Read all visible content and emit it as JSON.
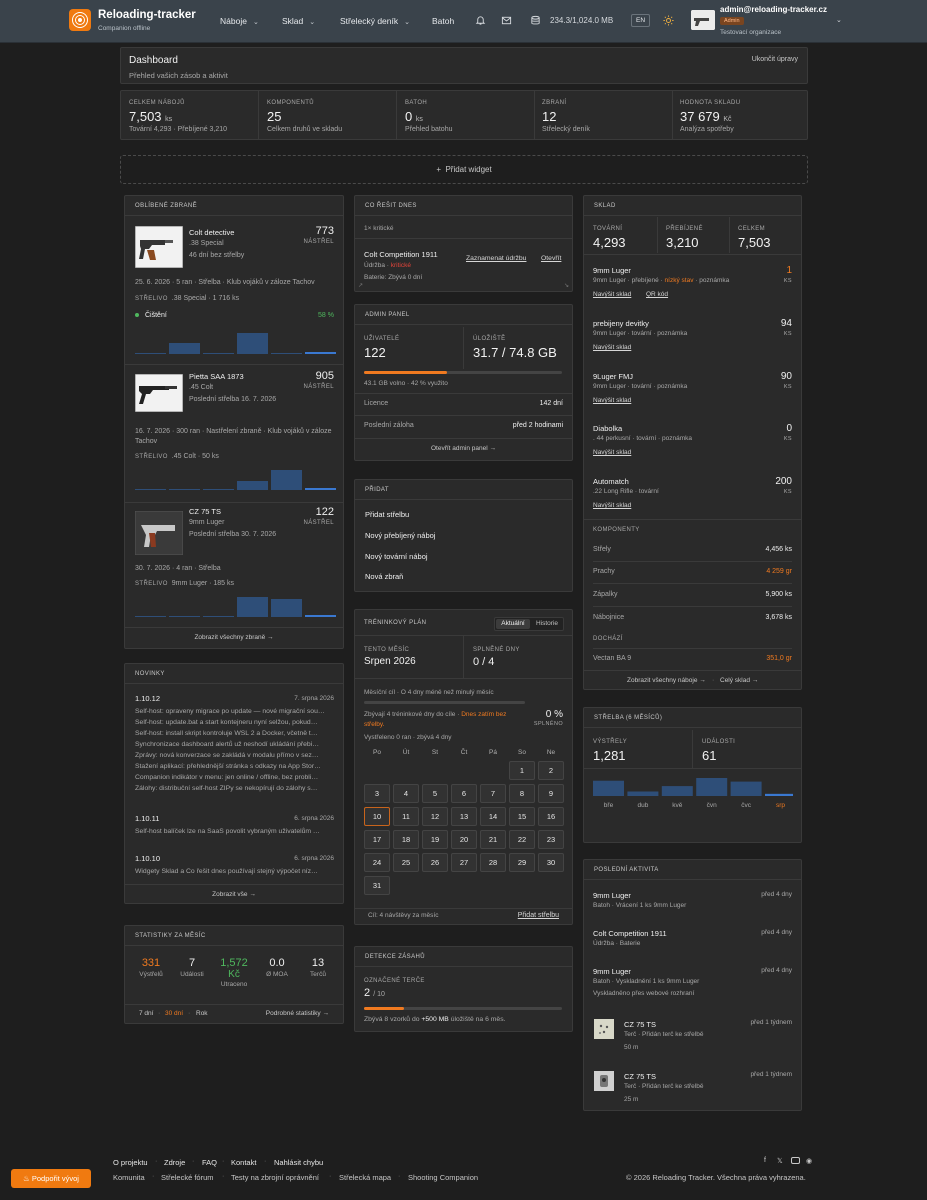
{
  "header": {
    "brand": "Reloading-tracker",
    "brand_sub": "Companion offline",
    "nav": [
      "Náboje",
      "Sklad",
      "Střelecký deník",
      "Batoh"
    ],
    "storage": "234.3/1,024.0 MB",
    "lang": "EN",
    "email": "admin@reloading-tracker.cz",
    "role": "Admin",
    "org": "Testovací organizace"
  },
  "dashboard": {
    "title": "Dashboard",
    "subtitle": "Přehled vašich zásob a aktivit",
    "end_edit": "Ukončit úpravy"
  },
  "stats": [
    {
      "label": "CELKEM NÁBOJŮ",
      "value": "7,503",
      "unit": "ks",
      "sub": "Tovární 4,293 · Přebíjené 3,210"
    },
    {
      "label": "KOMPONENTŮ",
      "value": "25",
      "unit": "",
      "sub": "Celkem druhů ve skladu"
    },
    {
      "label": "BATOH",
      "value": "0",
      "unit": "ks",
      "sub": "Přehled batohu"
    },
    {
      "label": "ZBRANÍ",
      "value": "12",
      "unit": "",
      "sub": "Střelecký deník"
    },
    {
      "label": "HODNOTA SKLADU",
      "value": "37 679",
      "unit": "Kč",
      "sub": "Analýza spotřeby"
    }
  ],
  "add_widget": "Přidat widget",
  "fav": {
    "title": "OBLÍBENÉ ZBRANĚ",
    "guns": [
      {
        "name": "Colt detective",
        "cal": ".38 Special",
        "last": "46 dní bez střelby",
        "shots": "773",
        "shots_label": "NÁSTŘEL",
        "log": "25. 6. 2026 · 5 ran · Střelba · Klub vojáků v záloze Tachov",
        "ammo_label": "STŘELIVO",
        "ammo": ".38 Special · 1 716 ks",
        "clean": "Čištění",
        "clean_pct": "58 %",
        "bars": [
          0.05,
          0.45,
          0.05,
          0.85,
          0.05,
          0.08
        ]
      },
      {
        "name": "Pietta SAA 1873",
        "cal": ".45 Colt",
        "last": "Poslední střelba 16. 7. 2026",
        "shots": "905",
        "shots_label": "NÁSTŘEL",
        "log": "16. 7. 2026 · 300 ran · Nastřelení zbraně · Klub vojáků v záloze Tachov",
        "ammo_label": "STŘELIVO",
        "ammo": ".45 Colt · 50 ks",
        "bars": [
          0.05,
          0.05,
          0.05,
          0.35,
          0.85,
          0.08
        ]
      },
      {
        "name": "CZ 75 TS",
        "cal": "9mm Luger",
        "last": "Poslední střelba 30. 7. 2026",
        "shots": "122",
        "shots_label": "NÁSTŘEL",
        "log": "30. 7. 2026 · 4 ran · Střelba",
        "ammo_label": "STŘELIVO",
        "ammo": "9mm Luger · 185 ks",
        "bars": [
          0.05,
          0.05,
          0.05,
          0.85,
          0.75,
          0.08
        ]
      }
    ],
    "show_all": "Zobrazit všechny zbraně →"
  },
  "news": {
    "title": "NOVINKY",
    "entries": [
      {
        "ver": "1.10.12",
        "date": "7. srpna 2026",
        "lines": [
          "Self-host: opraveny migrace po update — nové migrační sou…",
          "Self-host: update.bat a start kontejneru nyní selžou, pokud…",
          "Self-host: install skript kontroluje WSL 2 a Docker, včetně t…",
          "Synchronizace dashboard alertů už neshodí ukládání přebi…",
          "Zprávy: nová konverzace se zakládá v modalu přímo v sez…",
          "Stažení aplikací: přehlednější stránka s odkazy na App Stor…",
          "Companion indikátor v menu: jen online / offline, bez probli…",
          "Zálohy: distribuční self-host ZIPy se nekopírují do zálohy s…"
        ]
      },
      {
        "ver": "1.10.11",
        "date": "6. srpna 2026",
        "lines": [
          "Self-host balíček lze na SaaS povolit vybraným uživatelům …"
        ]
      },
      {
        "ver": "1.10.10",
        "date": "6. srpna 2026",
        "lines": [
          "Widgety Sklad a Co řešit dnes používají stejný výpočet níz…"
        ]
      }
    ],
    "show_all": "Zobrazit vše →"
  },
  "monthstats": {
    "title": "STATISTIKY ZA MĚSÍC",
    "items": [
      {
        "value": "331",
        "label": "Výstřelů"
      },
      {
        "value": "7",
        "label": "Události"
      },
      {
        "value": "1,572",
        "unit": "Kč",
        "label": "Utraceno"
      },
      {
        "value": "0.0",
        "label": "Ø MOA"
      },
      {
        "value": "13",
        "label": "Terčů"
      }
    ],
    "ranges": [
      "7 dní",
      "30 dní",
      "Rok"
    ],
    "detail": "Podrobné statistiky →"
  },
  "today": {
    "title": "CO ŘEŠIT DNES",
    "critical": "1× kritické",
    "item": "Colt Competition 1911",
    "item_sub1": "Údržba · ",
    "item_sub1b": "kritické",
    "item_sub2": "Baterie: Zbývá 0 dní",
    "act1": "Zaznamenat údržbu",
    "act2": "Otevřít"
  },
  "admin": {
    "title": "ADMIN PANEL",
    "users_label": "UŽIVATELÉ",
    "users": "122",
    "storage_label": "ÚLOŽIŠTĚ",
    "storage": "31.7 / 74.8 GB",
    "storage_fill": 0.42,
    "free": "43.1 GB volno · 42 % využito",
    "licence_label": "Licence",
    "licence": "142 dní",
    "backup_label": "Poslední záloha",
    "backup": "před 2 hodinami",
    "open": "Otevřít admin panel →"
  },
  "add": {
    "title": "PŘIDAT",
    "items": [
      "Přidat střelbu",
      "Nový přebíjený náboj",
      "Nový tovární náboj",
      "Nová zbraň"
    ]
  },
  "plan": {
    "title": "TRÉNINKOVÝ PLÁN",
    "tabs": [
      "Aktuální",
      "Historie"
    ],
    "month_label": "TENTO MĚSÍC",
    "month": "Srpen 2026",
    "done_label": "SPLNĚNÉ DNY",
    "done": "0 / 4",
    "goal": "Měsíční cíl · O 4 dny méně než minulý měsíc",
    "remain": "Zbývají 4 tréninkové dny do cíle · ",
    "remain_warn": "Dnes zatím bez",
    "remain_warn2": "střelby.",
    "pct": "0 %",
    "pct_label": "SPLNĚNO",
    "fulfilled": "Vystřeleno 0 ran · zbývá 4 dny",
    "weekdays": [
      "Po",
      "Út",
      "St",
      "Čt",
      "Pá",
      "So",
      "Ne"
    ],
    "days": [
      "1",
      "2",
      "3",
      "4",
      "5",
      "6",
      "7",
      "8",
      "9",
      "10",
      "11",
      "12",
      "13",
      "14",
      "15",
      "16",
      "17",
      "18",
      "19",
      "20",
      "21",
      "22",
      "23",
      "24",
      "25",
      "26",
      "27",
      "28",
      "29",
      "30",
      "31"
    ],
    "goal_foot": "Cíl: 4 návštěvy za měsíc",
    "add_foot": "Přidat střelbu"
  },
  "detect": {
    "title": "DETEKCE ZÁSAHŮ",
    "label": "OZNAČENÉ TERČE",
    "value": "2",
    "of": "/ 10",
    "fill": 0.2,
    "note_a": "Zbývá 8 vzorků do ",
    "note_b": "+500 MB",
    "note_c": " úložiště na 6 měs."
  },
  "stock": {
    "title": "SKLAD",
    "heads": [
      {
        "label": "TOVÁRNÍ",
        "value": "4,293"
      },
      {
        "label": "PŘEBÍJENÉ",
        "value": "3,210"
      },
      {
        "label": "CELKEM",
        "value": "7,503"
      }
    ],
    "items": [
      {
        "name": "9mm Luger",
        "sub": "9mm Luger · přebíjené · ",
        "warn": "nízký stav",
        "sub2": " · poznámka",
        "qty": "1",
        "unit": "KS",
        "links": [
          "Navýšit sklad",
          "QR kód"
        ]
      },
      {
        "name": "prebijeny devitky",
        "sub": "9mm Luger · tovární · poznámka",
        "qty": "94",
        "unit": "KS",
        "links": [
          "Navýšit sklad"
        ]
      },
      {
        "name": "9Luger FMJ",
        "sub": "9mm Luger · tovární · poznámka",
        "qty": "90",
        "unit": "KS",
        "links": [
          "Navýšit sklad"
        ]
      },
      {
        "name": "Diabolka",
        "sub": ". 44 perkusní · tovární · poznámka",
        "qty": "0",
        "unit": "KS",
        "links": [
          "Navýšit sklad"
        ]
      },
      {
        "name": "Automatch",
        "sub": ".22 Long Rifle · tovární",
        "qty": "200",
        "unit": "KS",
        "links": [
          "Navýšit sklad"
        ]
      }
    ],
    "comp_title": "KOMPONENTY",
    "comps": [
      {
        "name": "Střely",
        "qty": "4,456 ks"
      },
      {
        "name": "Prachy",
        "qty": "4 259 gr"
      },
      {
        "name": "Zápalky",
        "qty": "5,900 ks"
      },
      {
        "name": "Nábojnice",
        "qty": "3,678 ks"
      }
    ],
    "short_title": "DOCHÁZÍ",
    "short": {
      "name": "Vectan BA 9",
      "qty": "351,0 gr"
    },
    "foot1": "Zobrazit všechny náboje →",
    "foot2": "Celý sklad →"
  },
  "shooting": {
    "title": "STŘELBA (6 MĚSÍCŮ)",
    "shots_label": "VÝSTŘELY",
    "shots": "1,281",
    "events_label": "UDÁLOSTI",
    "events": "61",
    "chart_data": {
      "type": "bar",
      "categories": [
        "bře",
        "dub",
        "kvě",
        "čvn",
        "čvc",
        "srp"
      ],
      "values": [
        0.85,
        0.25,
        0.55,
        1.0,
        0.8,
        0.12
      ]
    }
  },
  "activity": {
    "title": "POSLEDNÍ AKTIVITA",
    "items": [
      {
        "name": "9mm Luger",
        "sub": "Batoh · Vrácení 1 ks 9mm Luger",
        "time": "před 4 dny"
      },
      {
        "name": "Colt Competition 1911",
        "sub": "Údržba · Baterie",
        "time": "před 4 dny"
      },
      {
        "name": "9mm Luger",
        "sub": "Batoh · Vyskladnění 1 ks 9mm Luger",
        "sub2": "Vyskladněno přes webové rozhraní",
        "time": "před 4 dny"
      },
      {
        "name": "CZ 75 TS",
        "sub": "Terč · Přidán terč ke střelbě",
        "sub2": "50 m",
        "time": "před 1 týdnem"
      },
      {
        "name": "CZ 75 TS",
        "sub": "Terč · Přidán terč ke střelbě",
        "sub2": "25 m",
        "time": "před 1 týdnem"
      }
    ]
  },
  "footer": {
    "support": "Podpořit vývoj",
    "links1": [
      "O projektu",
      "Zdroje",
      "FAQ",
      "Kontakt",
      "Nahlásit chybu"
    ],
    "links2": [
      "Komunita",
      "Střelecké fórum",
      "Testy na zbrojní oprávnění",
      "Střelecká mapa",
      "Shooting Companion"
    ],
    "copyright": "© 2026 Reloading Tracker. Všechna práva vyhrazena."
  }
}
